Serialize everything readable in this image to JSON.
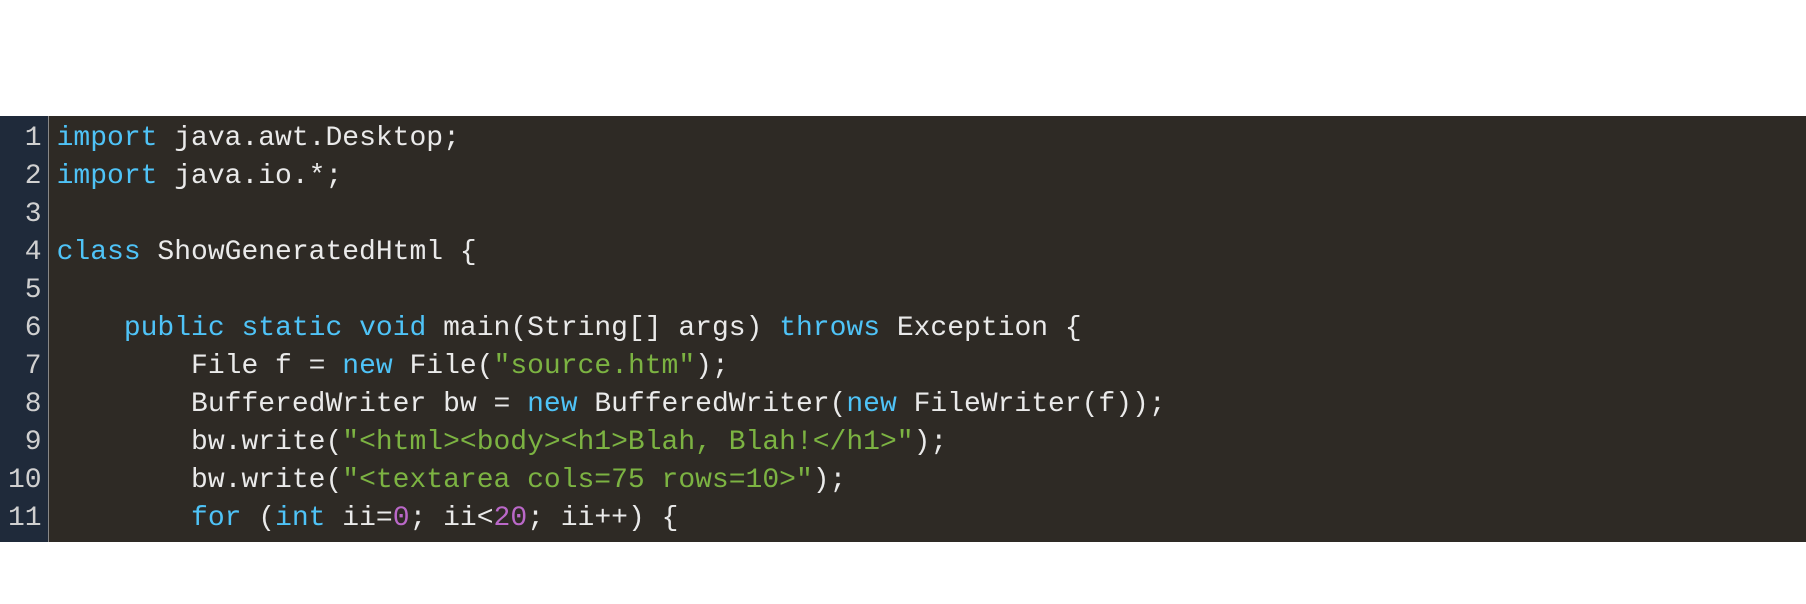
{
  "colors": {
    "editor_bg": "#2e2a25",
    "gutter_bg": "#1f2a3a",
    "keyword": "#4fc3f7",
    "string": "#7cb342",
    "number": "#ba68c8",
    "default": "#eaeaea"
  },
  "gutter": [
    "1",
    "2",
    "3",
    "4",
    "5",
    "6",
    "7",
    "8",
    "9",
    "10",
    "11"
  ],
  "lines": [
    [
      {
        "t": "import",
        "c": "keyword"
      },
      {
        "t": " java.awt.Desktop;",
        "c": "default"
      }
    ],
    [
      {
        "t": "import",
        "c": "keyword"
      },
      {
        "t": " java.io.*;",
        "c": "default"
      }
    ],
    [],
    [
      {
        "t": "class",
        "c": "keyword"
      },
      {
        "t": " ShowGeneratedHtml {",
        "c": "default"
      }
    ],
    [],
    [
      {
        "t": "    ",
        "c": "default"
      },
      {
        "t": "public",
        "c": "keyword"
      },
      {
        "t": " ",
        "c": "default"
      },
      {
        "t": "static",
        "c": "keyword"
      },
      {
        "t": " ",
        "c": "default"
      },
      {
        "t": "void",
        "c": "keyword"
      },
      {
        "t": " main(String[] args) ",
        "c": "default"
      },
      {
        "t": "throws",
        "c": "keyword"
      },
      {
        "t": " Exception {",
        "c": "default"
      }
    ],
    [
      {
        "t": "        File f = ",
        "c": "default"
      },
      {
        "t": "new",
        "c": "keyword"
      },
      {
        "t": " File(",
        "c": "default"
      },
      {
        "t": "\"source.htm\"",
        "c": "string"
      },
      {
        "t": ");",
        "c": "default"
      }
    ],
    [
      {
        "t": "        BufferedWriter bw = ",
        "c": "default"
      },
      {
        "t": "new",
        "c": "keyword"
      },
      {
        "t": " BufferedWriter(",
        "c": "default"
      },
      {
        "t": "new",
        "c": "keyword"
      },
      {
        "t": " FileWriter(f));",
        "c": "default"
      }
    ],
    [
      {
        "t": "        bw.write(",
        "c": "default"
      },
      {
        "t": "\"<html><body><h1>Blah, Blah!</h1>\"",
        "c": "string"
      },
      {
        "t": ");",
        "c": "default"
      }
    ],
    [
      {
        "t": "        bw.write(",
        "c": "default"
      },
      {
        "t": "\"<textarea cols=75 rows=10>\"",
        "c": "string"
      },
      {
        "t": ");",
        "c": "default"
      }
    ],
    [
      {
        "t": "        ",
        "c": "default"
      },
      {
        "t": "for",
        "c": "keyword"
      },
      {
        "t": " (",
        "c": "default"
      },
      {
        "t": "int",
        "c": "keyword"
      },
      {
        "t": " ii=",
        "c": "default"
      },
      {
        "t": "0",
        "c": "number"
      },
      {
        "t": "; ii<",
        "c": "default"
      },
      {
        "t": "20",
        "c": "number"
      },
      {
        "t": "; ii++) {",
        "c": "default"
      }
    ]
  ]
}
